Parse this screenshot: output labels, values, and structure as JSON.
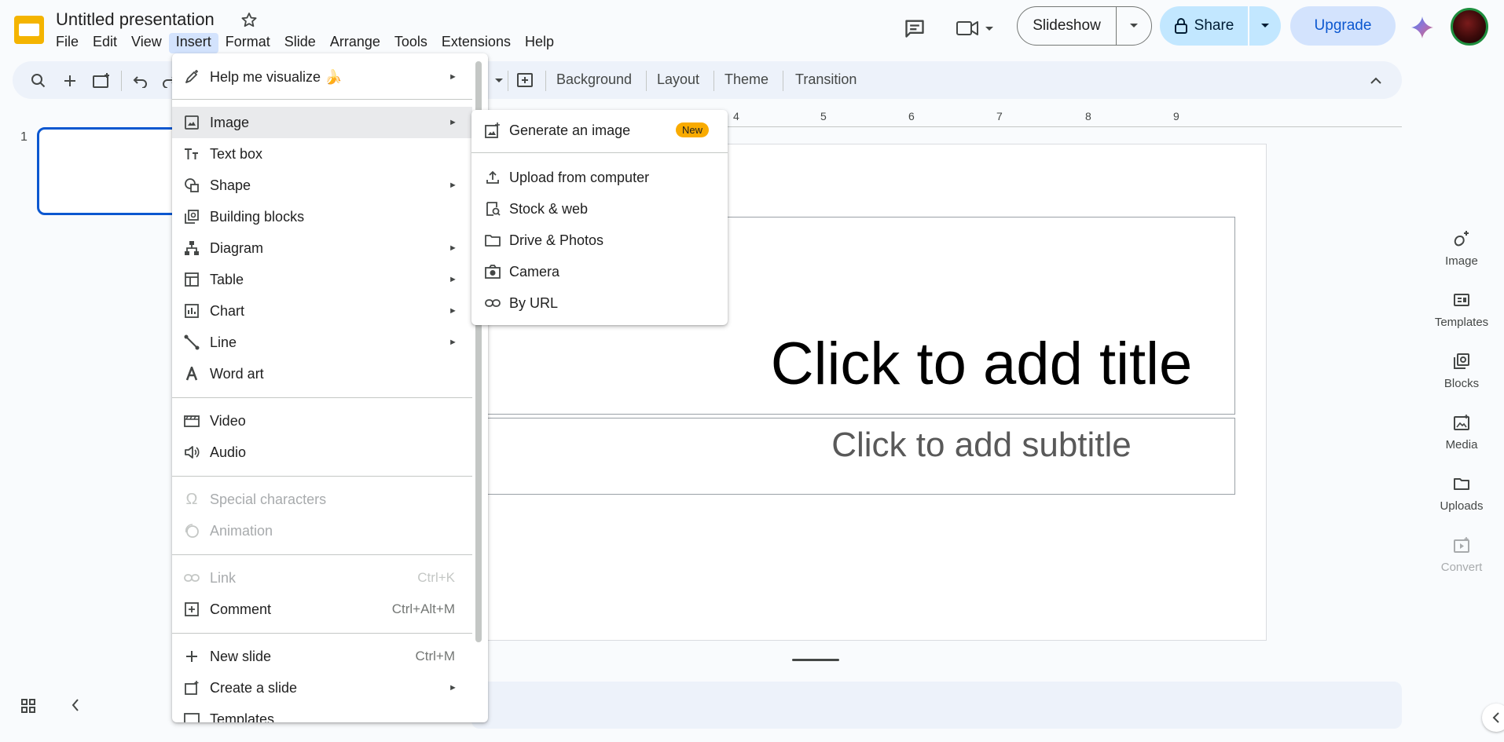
{
  "app": {
    "doc_title": "Untitled presentation",
    "menus": [
      "File",
      "Edit",
      "View",
      "Insert",
      "Format",
      "Slide",
      "Arrange",
      "Tools",
      "Extensions",
      "Help"
    ],
    "active_menu": "Insert"
  },
  "header": {
    "slideshow_label": "Slideshow",
    "share_label": "Share",
    "upgrade_label": "Upgrade"
  },
  "toolbar": {
    "background_label": "Background",
    "layout_label": "Layout",
    "theme_label": "Theme",
    "transition_label": "Transition"
  },
  "ruler": {
    "ticks": [
      "4",
      "5",
      "6",
      "7",
      "8",
      "9"
    ]
  },
  "filmstrip": {
    "slide_number": "1"
  },
  "slide": {
    "title_placeholder": "Click to add title",
    "subtitle_placeholder": "Click to add subtitle"
  },
  "side_panel": {
    "image": "Image",
    "templates": "Templates",
    "blocks": "Blocks",
    "media": "Media",
    "uploads": "Uploads",
    "convert": "Convert"
  },
  "insert_menu": {
    "help_visualize": "Help me visualize 🍌",
    "image": "Image",
    "text_box": "Text box",
    "shape": "Shape",
    "building_blocks": "Building blocks",
    "diagram": "Diagram",
    "table": "Table",
    "chart": "Chart",
    "line": "Line",
    "word_art": "Word art",
    "video": "Video",
    "audio": "Audio",
    "special_characters": "Special characters",
    "animation": "Animation",
    "link": "Link",
    "link_shortcut": "Ctrl+K",
    "comment": "Comment",
    "comment_shortcut": "Ctrl+Alt+M",
    "new_slide": "New slide",
    "new_slide_shortcut": "Ctrl+M",
    "create_slide": "Create a slide",
    "templates": "Templates"
  },
  "image_submenu": {
    "generate": "Generate an image",
    "new_badge": "New",
    "upload": "Upload from computer",
    "stock": "Stock & web",
    "drive": "Drive & Photos",
    "camera": "Camera",
    "url": "By URL"
  },
  "colors": {
    "accent": "#0b57d0",
    "share_bg": "#c2e7ff",
    "badge": "#f9ab00",
    "logo": "#f4b400"
  }
}
